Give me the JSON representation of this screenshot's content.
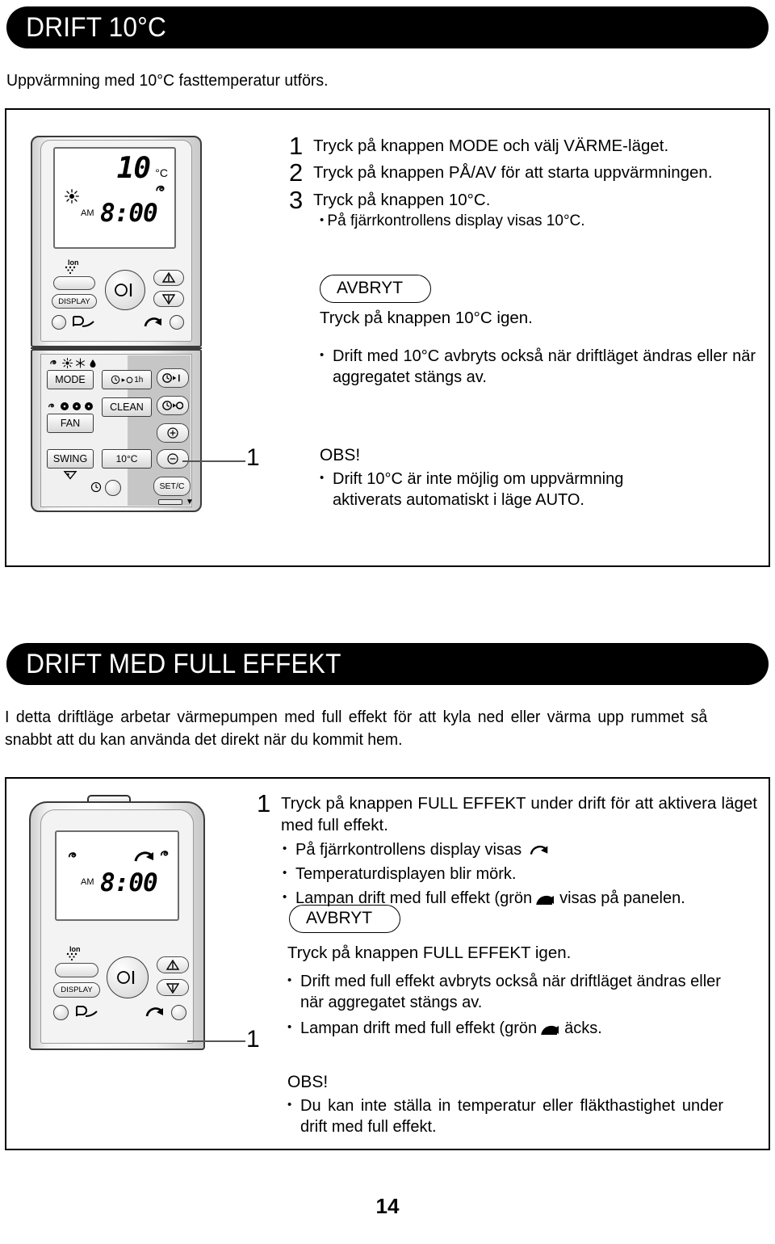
{
  "page": {
    "number": "14"
  },
  "section1": {
    "heading": "DRIFT 10°C",
    "intro": "Uppvärmning med 10°C fasttemperatur utförs.",
    "steps": [
      {
        "num": "1",
        "text": "Tryck på knappen MODE och välj VÄRME-läget."
      },
      {
        "num": "2",
        "text": "Tryck på knappen PÅ/AV för att starta uppvärmningen."
      },
      {
        "num": "3",
        "text": "Tryck på knappen 10°C.",
        "sub": "På fjärrkontrollens display visas 10°C."
      }
    ],
    "cancel": {
      "label": "AVBRYT",
      "line": "Tryck på knappen 10°C igen.",
      "bullets": [
        "Drift med 10°C avbryts också när driftläget ändras eller när aggregatet stängs av."
      ]
    },
    "note": {
      "title": "OBS!",
      "bullets": [
        "Drift 10°C är inte möjlig om uppvärmning aktiverats automatiskt i läge AUTO."
      ]
    },
    "marker": "1"
  },
  "section2": {
    "heading": "DRIFT MED FULL EFFEKT",
    "intro": "I detta driftläge arbetar värmepumpen med full effekt för att kyla ned eller värma upp rummet så snabbt att du kan använda det direkt när du kommit hem.",
    "step": {
      "num": "1",
      "text": "Tryck på knappen FULL EFFEKT under drift för att aktivera läget med full effekt.",
      "bullets": [
        "På fjärrkontrollens display visas",
        "Temperaturdisplayen blir mörk.",
        "Lampan drift med full effekt (grön"
      ],
      "bullet3_tail": "visas på panelen."
    },
    "cancel": {
      "label": "AVBRYT",
      "line": "Tryck på knappen FULL EFFEKT igen.",
      "bullets": [
        "Drift med full effekt avbryts också när driftläget ändras eller när aggregatet stängs av.",
        "Lampan drift med full effekt (grön"
      ],
      "bullet2_tail": "äcks."
    },
    "note": {
      "title": "OBS!",
      "bullets": [
        "Du kan inte ställa in temperatur eller fläkthastighet under drift med full effekt."
      ]
    },
    "marker": "1"
  },
  "remote1": {
    "lcd": {
      "temperature": "10",
      "unit": "°C",
      "meridiem": "AM",
      "time": "8:00",
      "icons": [
        "sun-icon",
        "fan-swirl-icon"
      ]
    },
    "ion_label": "Ion",
    "buttons": {
      "display": "DISPLAY",
      "mode": "MODE",
      "timer_1h": "1h",
      "clean": "CLEAN",
      "fan": "FAN",
      "swing": "SWING",
      "ten_degree": "10°C",
      "set_c": "SET/C"
    },
    "mode_icons": [
      "auto-swirl-icon",
      "sun-icon",
      "snowflake-icon",
      "droplet-icon"
    ],
    "fan_icons": [
      "auto-swirl-icon",
      "fan-low-icon",
      "fan-mid-icon",
      "fan-high-icon"
    ]
  },
  "remote2": {
    "lcd": {
      "meridiem": "AM",
      "time": "8:00",
      "icons": [
        "fan-swirl-icon",
        "full-power-icon",
        "fan-swirl-icon"
      ]
    },
    "ion_label": "Ion",
    "buttons": {
      "display": "DISPLAY"
    }
  },
  "colors": {
    "heading_bg": "#000000",
    "heading_fg": "#ffffff",
    "box_border": "#000000",
    "connector": "#555555"
  }
}
